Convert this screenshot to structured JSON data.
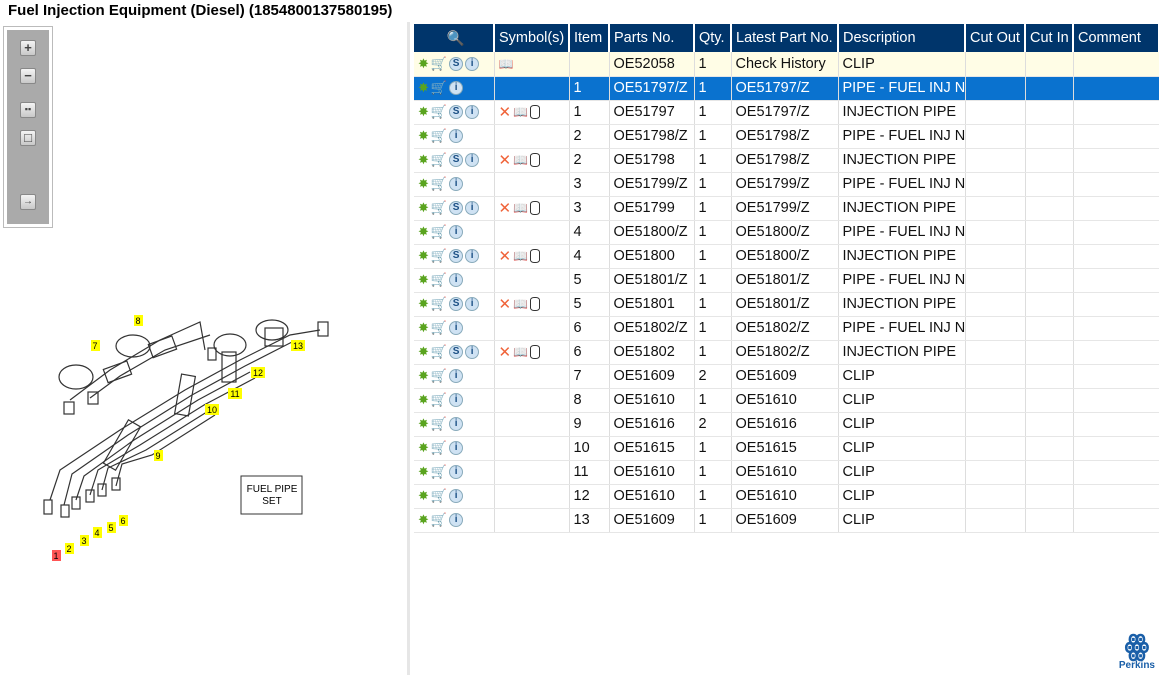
{
  "title": "Fuel Injection Equipment (Diesel) (1854800137580195)",
  "toolbar": [
    "zoom-in",
    "zoom-out",
    "fit-all",
    "fit-window",
    "export"
  ],
  "diagram": {
    "callouts": [
      "1",
      "2",
      "3",
      "4",
      "5",
      "6",
      "7",
      "8",
      "9",
      "10",
      "11",
      "12",
      "13"
    ],
    "label_line1": "FUEL PIPE",
    "label_line2": "SET"
  },
  "columns": [
    "",
    "Symbol(s)",
    "Item",
    "Parts No.",
    "Qty.",
    "Latest Part No.",
    "Description",
    "Cut Out",
    "Cut In",
    "Comment"
  ],
  "rows": [
    {
      "s": true,
      "sym": "b",
      "item": "",
      "part": "OE52058",
      "qty": "1",
      "latest": "Check History",
      "desc": "CLIP",
      "cls": "hl"
    },
    {
      "s": false,
      "sym": "",
      "item": "1",
      "part": "OE51797/Z",
      "qty": "1",
      "latest": "OE51797/Z",
      "desc": "PIPE - FUEL INJ NO",
      "cls": "sel"
    },
    {
      "s": true,
      "sym": "xbc",
      "item": "1",
      "part": "OE51797",
      "qty": "1",
      "latest": "OE51797/Z",
      "desc": "INJECTION PIPE"
    },
    {
      "s": false,
      "sym": "",
      "item": "2",
      "part": "OE51798/Z",
      "qty": "1",
      "latest": "OE51798/Z",
      "desc": "PIPE - FUEL INJ NO"
    },
    {
      "s": true,
      "sym": "xbc",
      "item": "2",
      "part": "OE51798",
      "qty": "1",
      "latest": "OE51798/Z",
      "desc": "INJECTION PIPE"
    },
    {
      "s": false,
      "sym": "",
      "item": "3",
      "part": "OE51799/Z",
      "qty": "1",
      "latest": "OE51799/Z",
      "desc": "PIPE - FUEL INJ NO"
    },
    {
      "s": true,
      "sym": "xbc",
      "item": "3",
      "part": "OE51799",
      "qty": "1",
      "latest": "OE51799/Z",
      "desc": "INJECTION PIPE"
    },
    {
      "s": false,
      "sym": "",
      "item": "4",
      "part": "OE51800/Z",
      "qty": "1",
      "latest": "OE51800/Z",
      "desc": "PIPE - FUEL INJ NO"
    },
    {
      "s": true,
      "sym": "xbc",
      "item": "4",
      "part": "OE51800",
      "qty": "1",
      "latest": "OE51800/Z",
      "desc": "INJECTION PIPE"
    },
    {
      "s": false,
      "sym": "",
      "item": "5",
      "part": "OE51801/Z",
      "qty": "1",
      "latest": "OE51801/Z",
      "desc": "PIPE - FUEL INJ NO"
    },
    {
      "s": true,
      "sym": "xbc",
      "item": "5",
      "part": "OE51801",
      "qty": "1",
      "latest": "OE51801/Z",
      "desc": "INJECTION PIPE"
    },
    {
      "s": false,
      "sym": "",
      "item": "6",
      "part": "OE51802/Z",
      "qty": "1",
      "latest": "OE51802/Z",
      "desc": "PIPE - FUEL INJ NO"
    },
    {
      "s": true,
      "sym": "xbc",
      "item": "6",
      "part": "OE51802",
      "qty": "1",
      "latest": "OE51802/Z",
      "desc": "INJECTION PIPE"
    },
    {
      "s": false,
      "sym": "",
      "item": "7",
      "part": "OE51609",
      "qty": "2",
      "latest": "OE51609",
      "desc": "CLIP"
    },
    {
      "s": false,
      "sym": "",
      "item": "8",
      "part": "OE51610",
      "qty": "1",
      "latest": "OE51610",
      "desc": "CLIP"
    },
    {
      "s": false,
      "sym": "",
      "item": "9",
      "part": "OE51616",
      "qty": "2",
      "latest": "OE51616",
      "desc": "CLIP"
    },
    {
      "s": false,
      "sym": "",
      "item": "10",
      "part": "OE51615",
      "qty": "1",
      "latest": "OE51615",
      "desc": "CLIP"
    },
    {
      "s": false,
      "sym": "",
      "item": "11",
      "part": "OE51610",
      "qty": "1",
      "latest": "OE51610",
      "desc": "CLIP"
    },
    {
      "s": false,
      "sym": "",
      "item": "12",
      "part": "OE51610",
      "qty": "1",
      "latest": "OE51610",
      "desc": "CLIP"
    },
    {
      "s": false,
      "sym": "",
      "item": "13",
      "part": "OE51609",
      "qty": "1",
      "latest": "OE51609",
      "desc": "CLIP"
    }
  ],
  "brand": "Perkins",
  "colors": {
    "header": "#00356b",
    "selected": "#0a72cf",
    "highlight": "#fffde6",
    "callout": "#ffff00"
  }
}
